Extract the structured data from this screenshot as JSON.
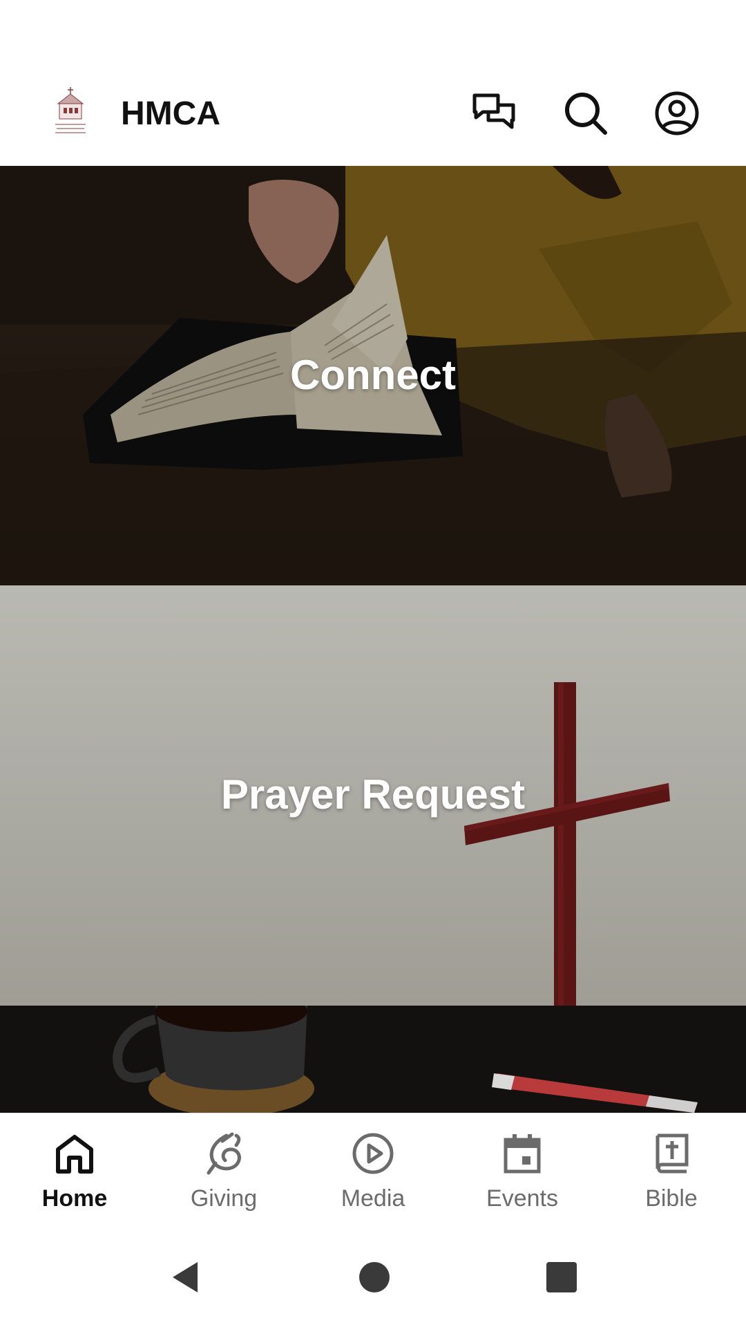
{
  "header": {
    "title": "HMCA",
    "logo_icon": "church-logo-icon",
    "actions": [
      {
        "name": "messages",
        "icon": "chat-bubbles-icon"
      },
      {
        "name": "search",
        "icon": "search-icon"
      },
      {
        "name": "profile",
        "icon": "account-circle-icon"
      }
    ]
  },
  "feed": {
    "tiles": [
      {
        "label": "Connect",
        "image": "open-bible-on-table"
      },
      {
        "label": "Prayer Request",
        "image": "red-cross-on-grey"
      },
      {
        "label": "",
        "image": "coffee-mug-and-marker"
      }
    ]
  },
  "bottom_nav": {
    "items": [
      {
        "label": "Home",
        "icon": "home-icon",
        "active": true
      },
      {
        "label": "Giving",
        "icon": "giving-hand-icon",
        "active": false
      },
      {
        "label": "Media",
        "icon": "play-circle-icon",
        "active": false
      },
      {
        "label": "Events",
        "icon": "calendar-icon",
        "active": false
      },
      {
        "label": "Bible",
        "icon": "bible-cross-icon",
        "active": false
      }
    ],
    "active_color": "#111111",
    "inactive_color": "#6b6b6b"
  },
  "system_nav": {
    "back": "back-triangle-icon",
    "home": "home-circle-icon",
    "recents": "recents-square-icon"
  }
}
